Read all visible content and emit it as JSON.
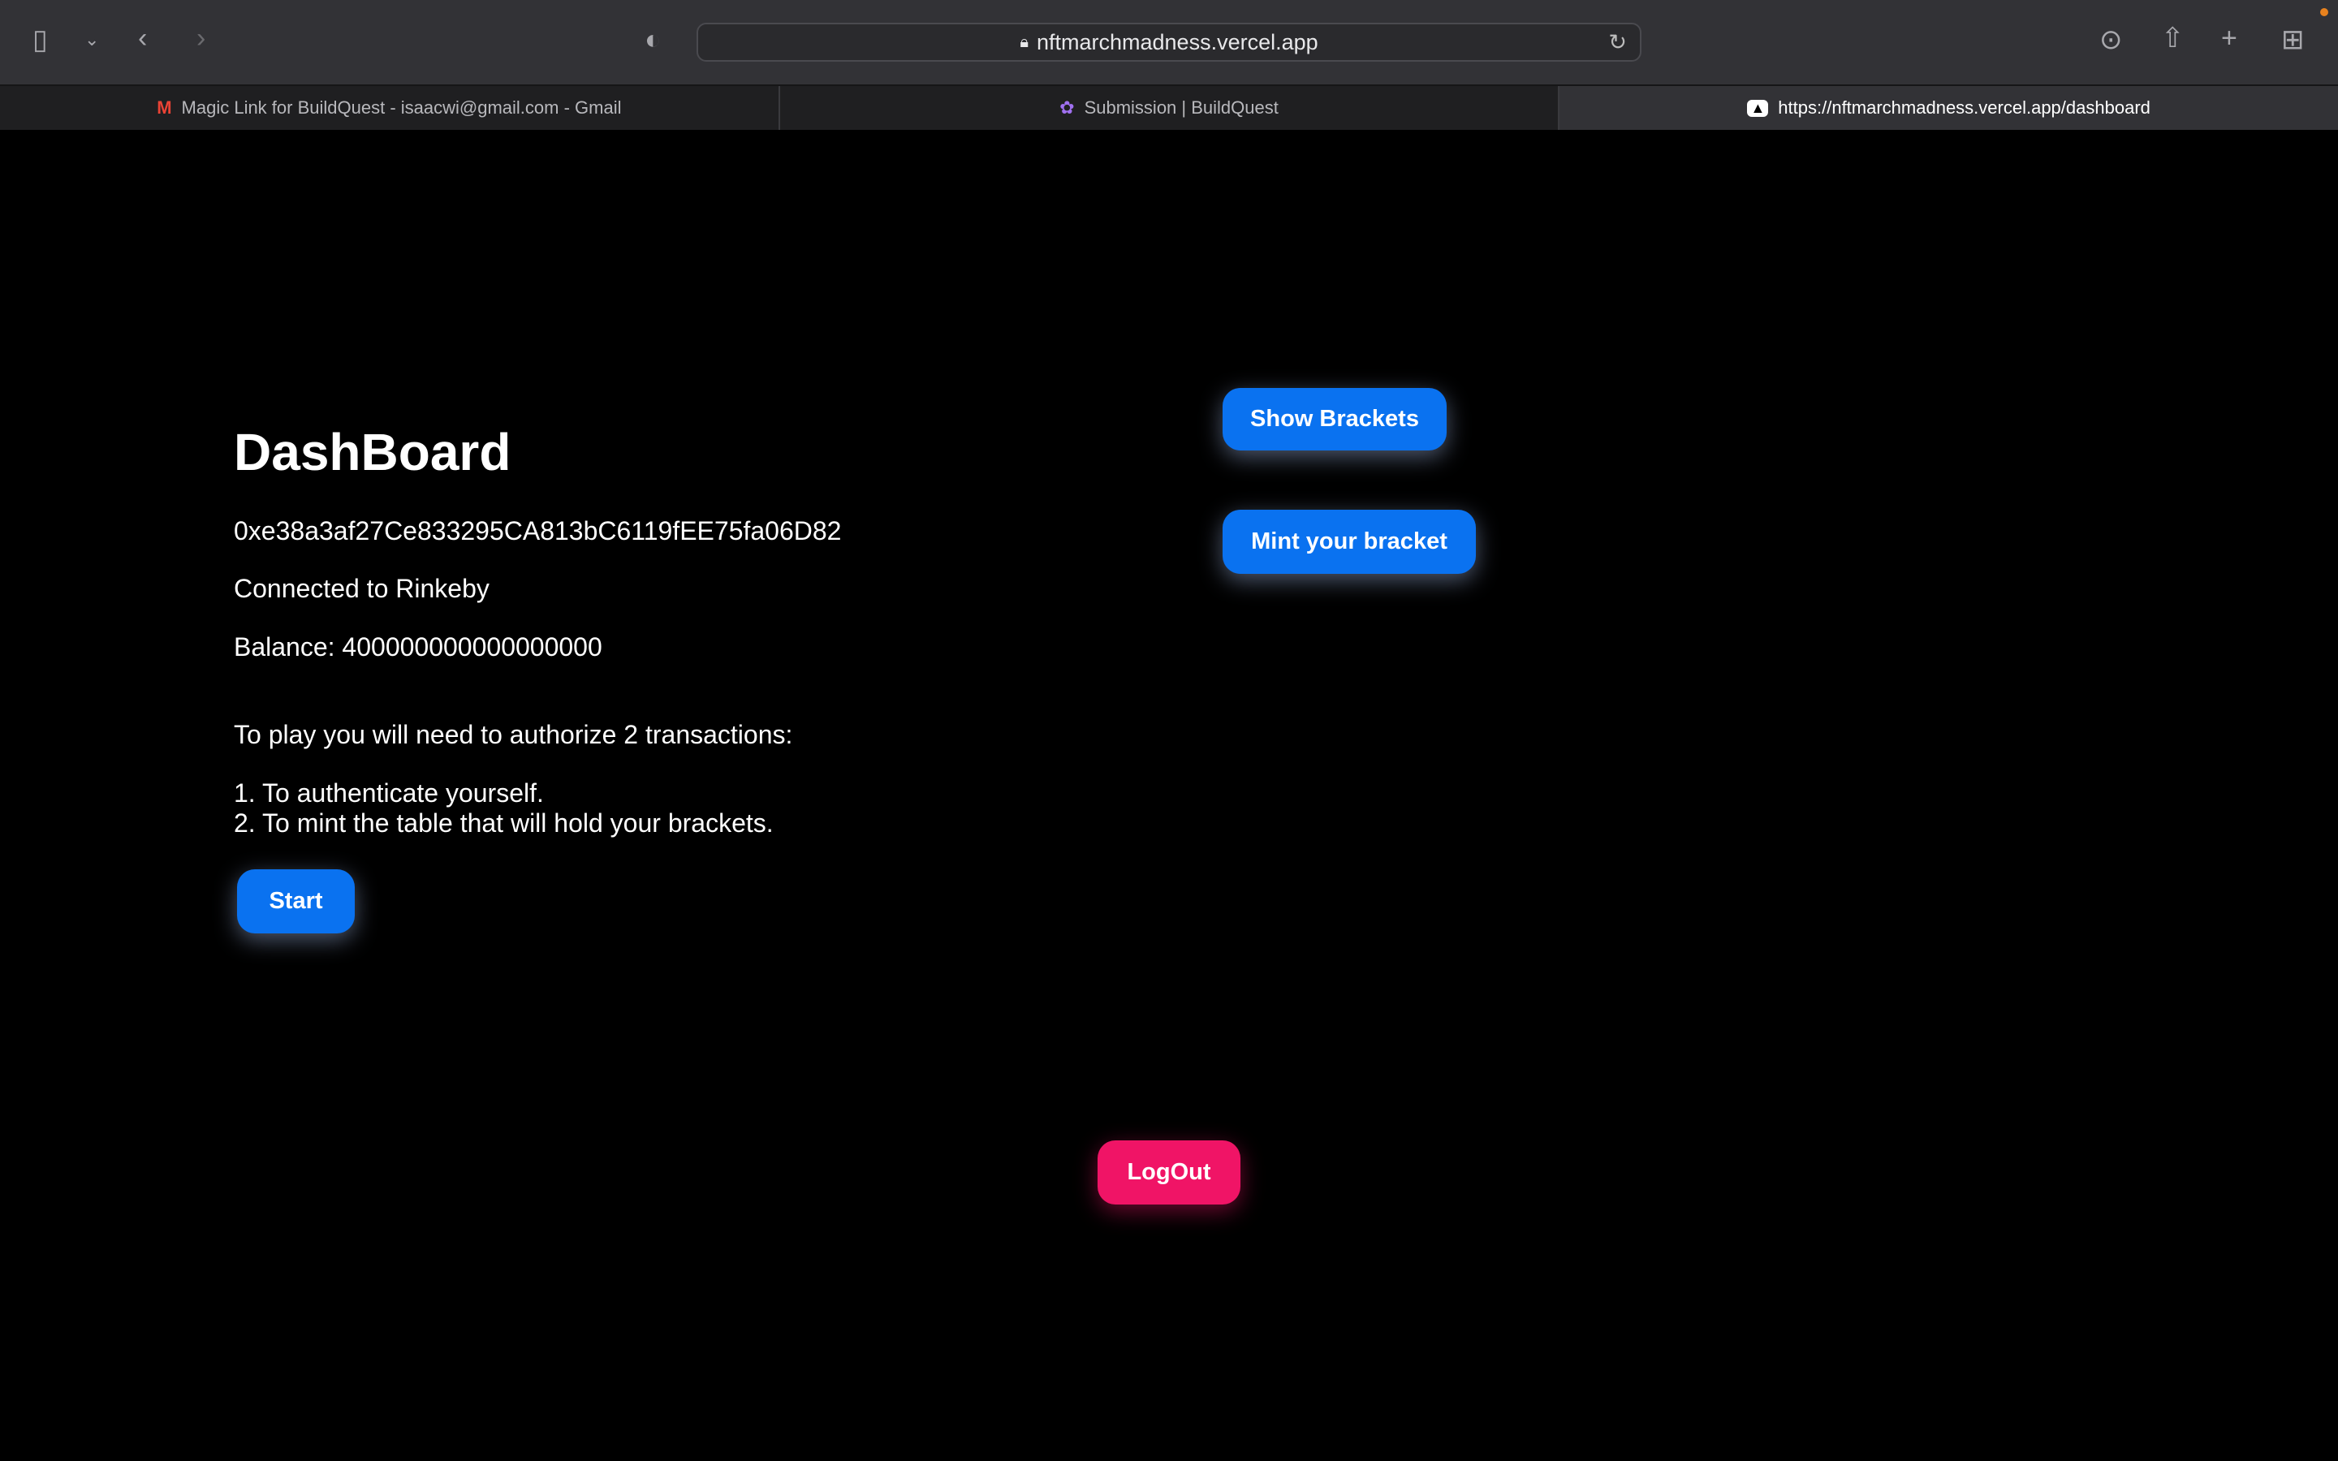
{
  "browser": {
    "url": "nftmarchmadness.vercel.app",
    "tabs": [
      {
        "label": "Magic Link for BuildQuest - isaacwi@gmail.com - Gmail",
        "icon": "gmail-icon"
      },
      {
        "label": "Submission | BuildQuest",
        "icon": "buildquest-icon"
      },
      {
        "label": "https://nftmarchmadness.vercel.app/dashboard",
        "icon": "vercel-icon"
      }
    ]
  },
  "main": {
    "title": "DashBoard",
    "address": "0xe38a3af27Ce833295CA813bC6119fEE75fa06D82",
    "network": "Connected to Rinkeby",
    "balance": "Balance: 400000000000000000",
    "instructions": "To play you will need to authorize 2 transactions:",
    "step1": "1. To authenticate yourself.",
    "step2": "2. To mint the table that will hold your brackets.",
    "start": "Start",
    "show_brackets": "Show Brackets",
    "mint": "Mint your bracket",
    "logout": "LogOut"
  },
  "colors": {
    "primary": "#0a72f0",
    "logout": "#f01466"
  }
}
